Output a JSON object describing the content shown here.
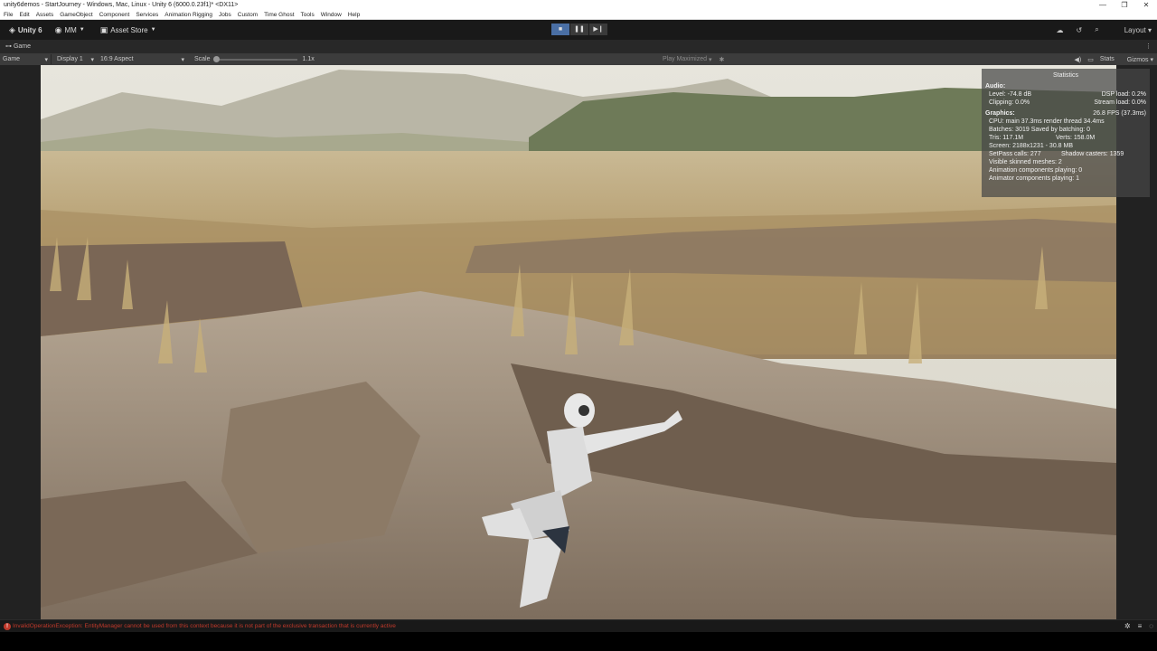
{
  "window": {
    "title": "unity6demos - StartJourney - Windows, Mac, Linux - Unity 6 (6000.0.23f1)* <DX11>",
    "controls": [
      "—",
      "❐",
      "✕"
    ]
  },
  "menu": [
    "File",
    "Edit",
    "Assets",
    "GameObject",
    "Component",
    "Services",
    "Animation Rigging",
    "Jobs",
    "Custom",
    "Time Ghost",
    "Tools",
    "Window",
    "Help"
  ],
  "toolbar": {
    "unity_label": "Unity 6",
    "account_label": "MM",
    "asset_store_label": "Asset Store",
    "layout_label": "Layout"
  },
  "tab": {
    "label": "Game"
  },
  "gamebar": {
    "mode": "Game",
    "display": "Display 1",
    "aspect": "16:9 Aspect",
    "scale_label": "Scale",
    "scale_value": "1.1x",
    "play_mode": "Play Maximized",
    "stats_label": "Stats",
    "gizmos_label": "Gizmos"
  },
  "stats": {
    "title": "Statistics",
    "audio_label": "Audio:",
    "level": "Level: -74.8 dB",
    "dsp": "DSP load: 0.2%",
    "clipping": "Clipping: 0.0%",
    "stream": "Stream load: 0.0%",
    "graphics_label": "Graphics:",
    "fps": "26.8 FPS (37.3ms)",
    "cpu": "CPU: main 37.3ms  render thread 34.4ms",
    "batches": "Batches: 3019  Saved by batching: 0",
    "tris": "Tris: 117.1M",
    "verts": "Verts: 158.0M",
    "screen": "Screen: 2188x1231 - 30.8 MB",
    "setpass": "SetPass calls: 277",
    "shadow": "Shadow casters: 1359",
    "skinned": "Visible skinned meshes: 2",
    "anim": "Animation components playing: 0",
    "animator": "Animator components playing: 1"
  },
  "status": {
    "error": "InvalidOperationException: EntityManager cannot be used from this context because it is not part of the exclusive transaction that is currently active"
  },
  "colors": {
    "editor_bg": "#191919",
    "error_red": "#c0392b",
    "play_active": "#4a6fa5"
  }
}
